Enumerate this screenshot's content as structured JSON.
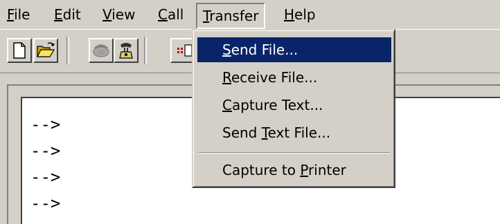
{
  "menubar": {
    "file": {
      "u": "F",
      "rest": "ile"
    },
    "edit": {
      "u": "E",
      "rest": "dit"
    },
    "view": {
      "u": "V",
      "rest": "iew"
    },
    "call": {
      "u": "C",
      "rest": "all"
    },
    "transfer": {
      "u": "T",
      "rest": "ransfer"
    },
    "help": {
      "u": "H",
      "rest": "elp"
    }
  },
  "toolbar": {
    "icons": [
      "new-document-icon",
      "open-folder-icon",
      "disconnected-phone-icon",
      "connect-phone-icon",
      "properties-icon"
    ]
  },
  "transfer_menu": {
    "send_file": {
      "u": "S",
      "rest": "end File..."
    },
    "receive_file": {
      "u": "R",
      "rest": "eceive File..."
    },
    "capture_text": {
      "u": "C",
      "rest": "apture Text..."
    },
    "send_text_file": {
      "pre": "Send ",
      "u": "T",
      "rest": "ext File..."
    },
    "capture_printer": {
      "pre": "Capture to ",
      "u": "P",
      "rest": "rinter"
    }
  },
  "terminal": {
    "lines": [
      "-->",
      "-->",
      "-->",
      "-->"
    ]
  },
  "colors": {
    "face": "#d4d0c8",
    "highlight": "#0a246a",
    "highlight_text": "#ffffff"
  }
}
